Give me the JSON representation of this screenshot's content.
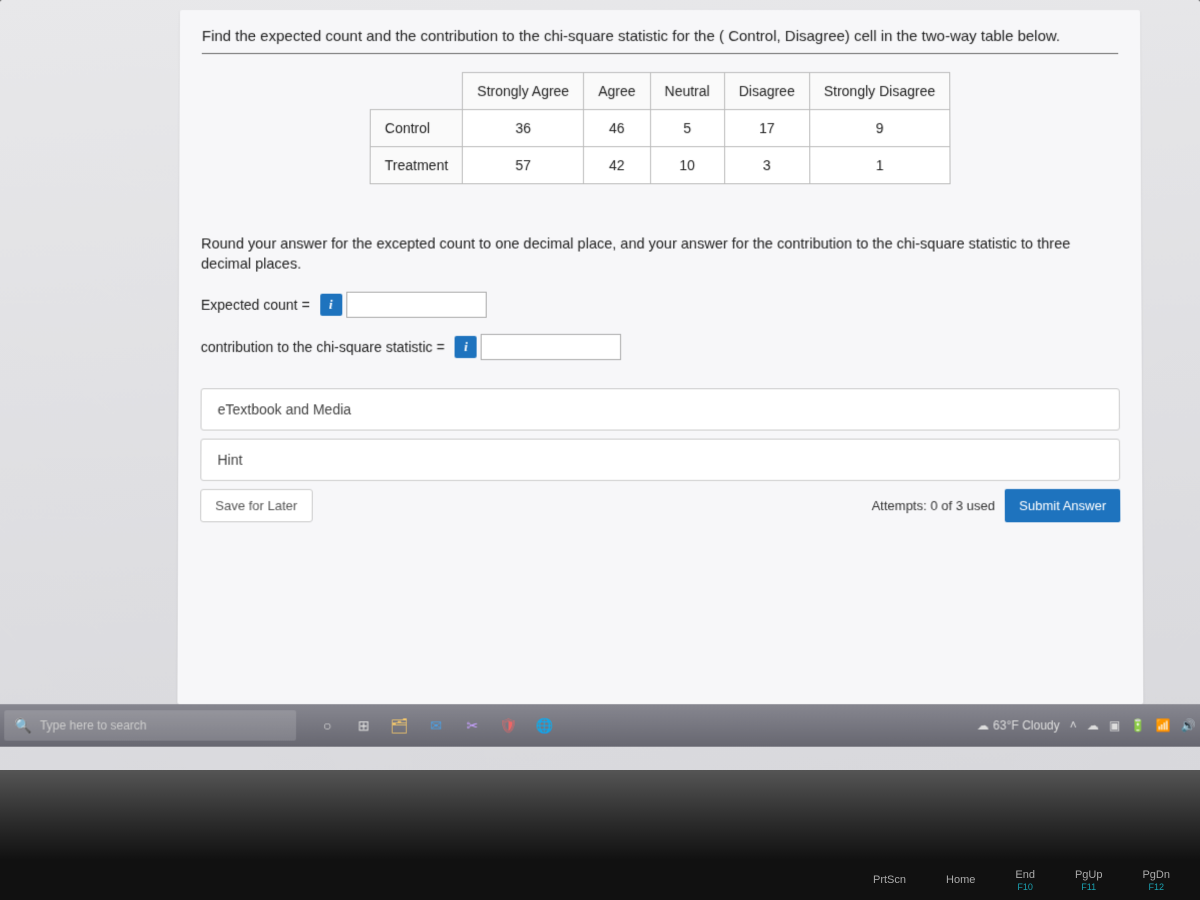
{
  "question": "Find the expected count and the contribution to the chi-square statistic for the ( Control, Disagree) cell in the two-way table below.",
  "table": {
    "col_headers": [
      "Strongly Agree",
      "Agree",
      "Neutral",
      "Disagree",
      "Strongly Disagree"
    ],
    "rows": [
      {
        "label": "Control",
        "cells": [
          "36",
          "46",
          "5",
          "17",
          "9"
        ]
      },
      {
        "label": "Treatment",
        "cells": [
          "57",
          "42",
          "10",
          "3",
          "1"
        ]
      }
    ]
  },
  "instructions": "Round your answer for the excepted count to one decimal place, and your answer for the contribution to the chi-square statistic to three decimal places.",
  "answers": {
    "expected_label": "Expected count =",
    "contribution_label": "contribution to the chi-square statistic =",
    "info_glyph": "i"
  },
  "buttons": {
    "etextbook": "eTextbook and Media",
    "hint": "Hint",
    "save": "Save for Later",
    "attempts": "Attempts: 0 of 3 used",
    "submit": "Submit Answer"
  },
  "taskbar": {
    "search_placeholder": "Type here to search",
    "weather": "63°F Cloudy"
  },
  "keys": {
    "prtscn": "PrtScn",
    "home": "Home",
    "end": "End",
    "pgup": "PgUp",
    "pgdn": "PgDn",
    "f10": "F10",
    "f11": "F11",
    "f12": "F12"
  }
}
